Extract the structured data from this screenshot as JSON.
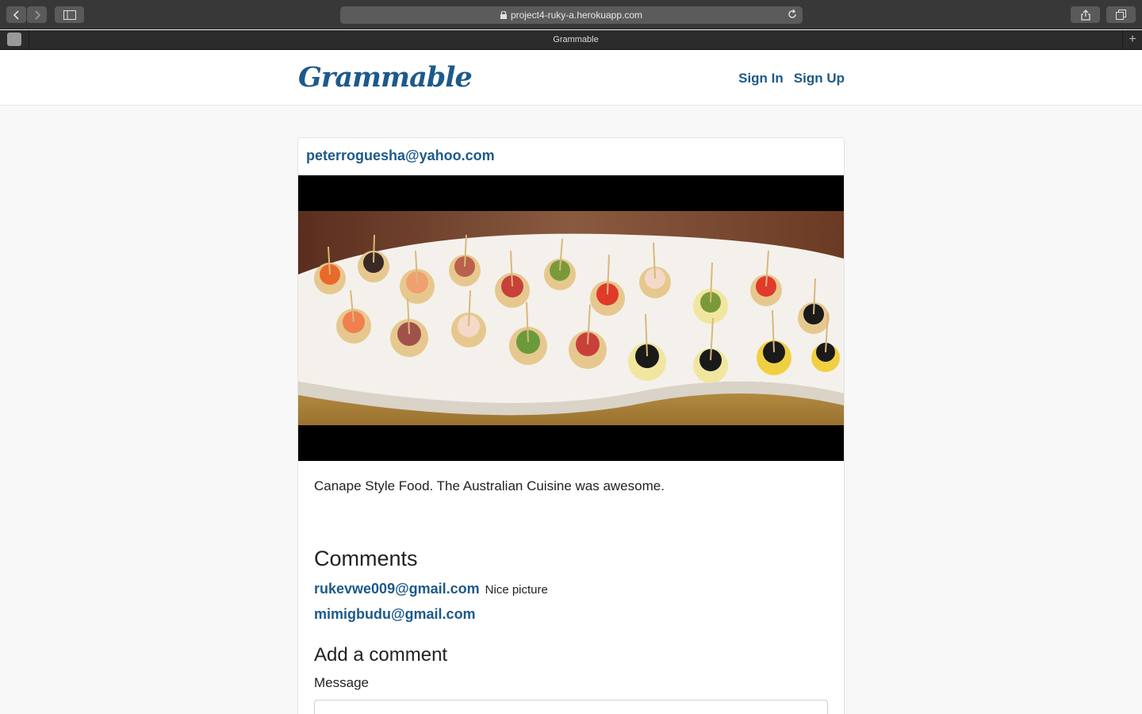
{
  "browser": {
    "url": "project4-ruky-a.herokuapp.com",
    "tab_title": "Grammable"
  },
  "header": {
    "brand": "Grammable",
    "sign_in": "Sign In",
    "sign_up": "Sign Up"
  },
  "post": {
    "author": "peterroguesha@yahoo.com",
    "caption": "Canape Style Food. The Australian Cuisine was awesome."
  },
  "comments": {
    "title": "Comments",
    "items": [
      {
        "author": "rukevwe009@gmail.com",
        "text": "Nice picture"
      },
      {
        "author": "mimigbudu@gmail.com",
        "text": ""
      }
    ]
  },
  "add_comment": {
    "title": "Add a comment",
    "message_label": "Message"
  },
  "colors": {
    "brand": "#1d5a8a",
    "page_bg": "#f8f8f8"
  }
}
